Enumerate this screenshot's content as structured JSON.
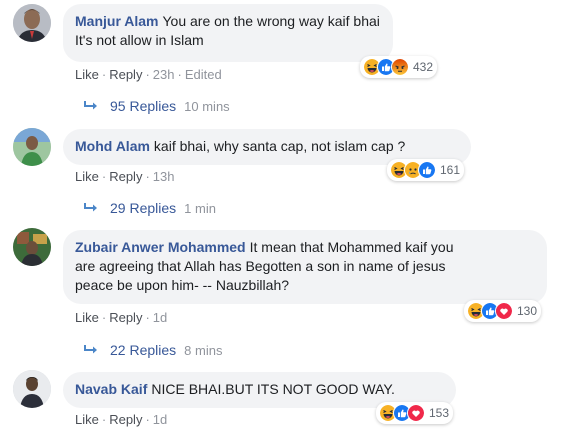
{
  "colors": {
    "author": "#385898",
    "bubble_bg": "#f2f3f5",
    "meta": "#90949c",
    "link": "#4b4f56",
    "haha_yellow": "#f7b125",
    "like_blue": "#1877f2",
    "angry_orange": "#e9710f",
    "love_red": "#f0284a"
  },
  "comments": [
    {
      "author": "Manjur Alam",
      "text_line1": "You are on the wrong way kaif bhai",
      "text_line2": "It's not allow in Islam",
      "reaction_count": "432",
      "reaction_icons": [
        "haha-icon",
        "like-icon",
        "angry-icon"
      ],
      "like_label": "Like",
      "reply_label": "Reply",
      "time": "23h",
      "edited": "Edited",
      "replies_label": "95 Replies",
      "replies_time": "10 mins"
    },
    {
      "author": "Mohd Alam",
      "text_line1": "kaif bhai, why santa cap, not islam cap ?",
      "reaction_count": "161",
      "reaction_icons": [
        "haha-icon",
        "sad-icon",
        "like-icon"
      ],
      "like_label": "Like",
      "reply_label": "Reply",
      "time": "13h",
      "replies_label": "29 Replies",
      "replies_time": "1 min"
    },
    {
      "author": "Zubair Anwer Mohammed",
      "text_line1": "It mean that Mohammed kaif you",
      "text_line2": "are agreeing that Allah has Begotten a son in name of jesus",
      "text_line3": "peace be upon him- -- Nauzbillah?",
      "reaction_count": "130",
      "reaction_icons": [
        "haha-icon",
        "like-icon",
        "love-icon"
      ],
      "like_label": "Like",
      "reply_label": "Reply",
      "time": "1d",
      "replies_label": "22 Replies",
      "replies_time": "8 mins"
    },
    {
      "author": "Navab Kaif",
      "text_line1": "NICE BHAI.BUT ITS NOT GOOD WAY.",
      "reaction_count": "153",
      "reaction_icons": [
        "haha-icon",
        "like-icon",
        "love-icon"
      ],
      "like_label": "Like",
      "reply_label": "Reply",
      "time": "1d"
    }
  ]
}
